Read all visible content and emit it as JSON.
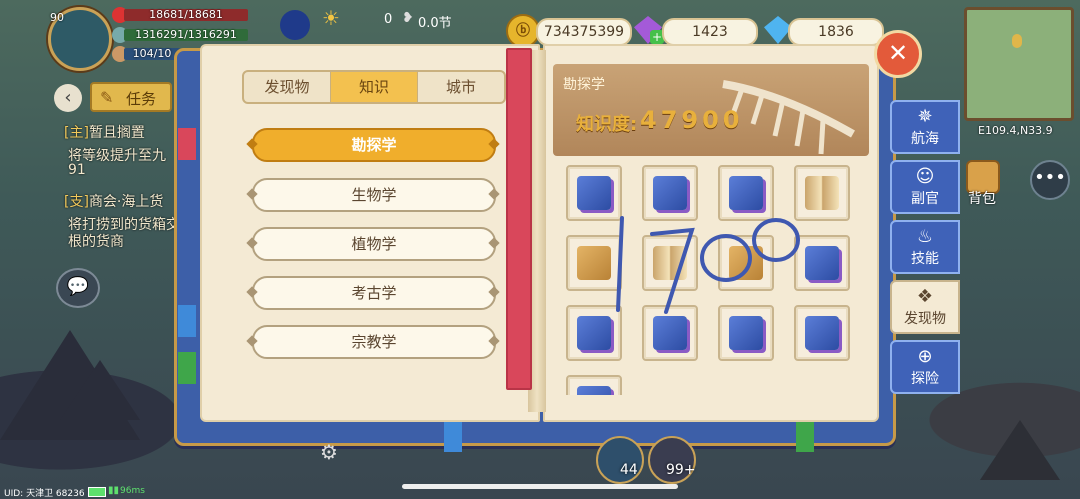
{
  "player": {
    "level": "90",
    "hp": "18681/18681",
    "mp": "1316291/1316291",
    "exp": "104/10"
  },
  "hud": {
    "count": "0",
    "speed": "0.0节"
  },
  "resources": {
    "gold": "734375399",
    "purple_gems": "1423",
    "blue_gems": "1836"
  },
  "quest": {
    "button_label": "任务",
    "items": [
      {
        "tag": "[主]",
        "title": "暂且搁置",
        "desc": "将等级提升至九",
        "desc2": "91"
      },
      {
        "tag": "[支]",
        "title": "商会·海上货",
        "desc": "将打捞到的货箱交",
        "desc2": "根的货商"
      }
    ]
  },
  "book": {
    "tabs": [
      {
        "label": "发现物"
      },
      {
        "label": "知识"
      },
      {
        "label": "城市"
      }
    ],
    "active_tab": "知识",
    "categories": [
      {
        "label": "勘探学"
      },
      {
        "label": "生物学"
      },
      {
        "label": "植物学"
      },
      {
        "label": "考古学"
      },
      {
        "label": "宗教学"
      }
    ],
    "active_category": "勘探学",
    "right_page": {
      "title": "勘探学",
      "knowledge_label": "知识度:",
      "knowledge_value": "47900"
    },
    "items": [
      "blue",
      "blue",
      "blue",
      "open",
      "map",
      "open",
      "map",
      "blue",
      "blue",
      "blue",
      "blue",
      "blue",
      "blue"
    ],
    "handwriting": "1700"
  },
  "side_nav": [
    {
      "label": "航海",
      "icon": "compass-icon"
    },
    {
      "label": "副官",
      "icon": "officer-icon"
    },
    {
      "label": "技能",
      "icon": "flame-icon"
    },
    {
      "label": "发现物",
      "icon": "discovery-icon"
    },
    {
      "label": "探险",
      "icon": "explore-icon"
    }
  ],
  "minimap": {
    "coords": "E109.4,N33.9"
  },
  "bag_label": "背包",
  "bottom": {
    "uid": "UID: 天津卫 68236",
    "ping": "96ms",
    "badge1": "44",
    "badge2": "99+"
  },
  "colors": {
    "accent_orange": "#f0ae2c",
    "nav_blue": "#3f62b8",
    "page_beige": "#f4ead4",
    "close_red": "#e35a3a"
  }
}
